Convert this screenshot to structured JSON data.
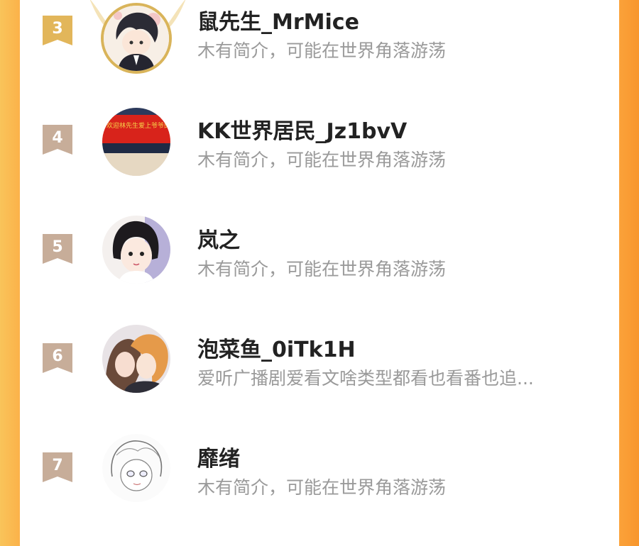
{
  "colors": {
    "left_band": "#f9c45a",
    "right_band": "#f8962d",
    "gold_badge": "#e2b65a",
    "bronze_badge": "#c7ad99",
    "name_text": "#222222",
    "bio_text": "#9a9a9a"
  },
  "ranking": [
    {
      "rank": "3",
      "name": "鼠先生_MrMice",
      "bio": "木有简介，可能在世界角落游荡",
      "avatar": "anime-boy-gold-frame-avatar",
      "badge": "gold-ribbon-icon"
    },
    {
      "rank": "4",
      "name": "KK世界居民_Jz1bvV",
      "bio": "木有简介，可能在世界角落游荡",
      "avatar": "red-banner-photo-avatar",
      "badge": "bronze-ribbon-icon"
    },
    {
      "rank": "5",
      "name": "岚之",
      "bio": "木有简介，可能在世界角落游荡",
      "avatar": "anime-girl-avatar",
      "badge": "bronze-ribbon-icon"
    },
    {
      "rank": "6",
      "name": "泡菜鱼_0iTk1H",
      "bio": "爱听广播剧爱看文啥类型都看也看番也追...",
      "avatar": "couple-illustration-avatar",
      "badge": "bronze-ribbon-icon"
    },
    {
      "rank": "7",
      "name": "靡绪",
      "bio": "木有简介，可能在世界角落游荡",
      "avatar": "sketch-girl-avatar",
      "badge": "bronze-ribbon-icon"
    }
  ]
}
